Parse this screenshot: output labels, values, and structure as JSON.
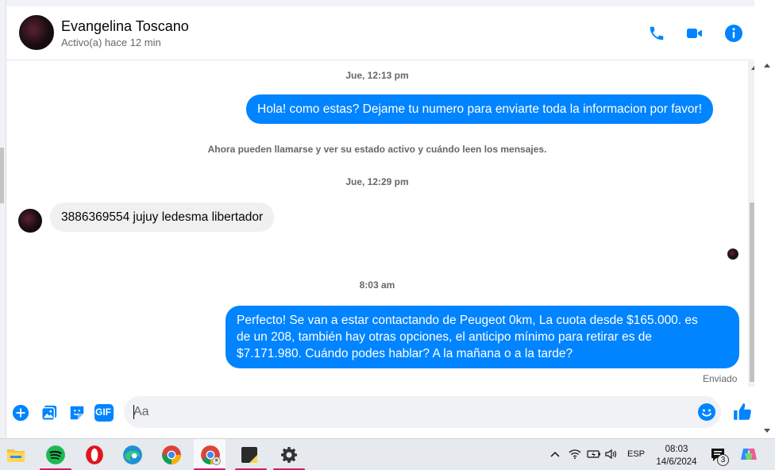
{
  "contact": {
    "name": "Evangelina Toscano",
    "status": "Activo(a) hace 12 min"
  },
  "icons": {
    "call": "phone-icon",
    "video": "video-camera-icon",
    "info": "info-icon"
  },
  "messages": {
    "ts1": "Jue, 12:13 pm",
    "msg1": "Hola! como estas? Dejame tu numero para enviarte toda la informacion por favor!",
    "sys1": "Ahora pueden llamarse y ver su estado activo y cuándo leen los mensajes.",
    "ts2": "Jue, 12:29 pm",
    "msg2": "3886369554 jujuy ledesma libertador",
    "ts3": "8:03 am",
    "msg3_line1": "Perfecto!  Se van a estar contactando de Peugeot 0km, La cuota desde $165.000. es",
    "msg3_line2": "de un 208, también hay otras opciones, el anticipo mínimo para retirar es de",
    "msg3_line3": "$7.171.980. Cuándo podes hablar? A la mañana o a la tarde?",
    "sent": "Enviado"
  },
  "composer": {
    "placeholder": "Aa",
    "gif_label": "GIF"
  },
  "taskbar": {
    "lang": "ESP",
    "time": "08:03",
    "date": "14/6/2024",
    "notif_count": "3"
  },
  "colors": {
    "accent": "#0084ff",
    "bubble_in": "#f0f0f0"
  }
}
